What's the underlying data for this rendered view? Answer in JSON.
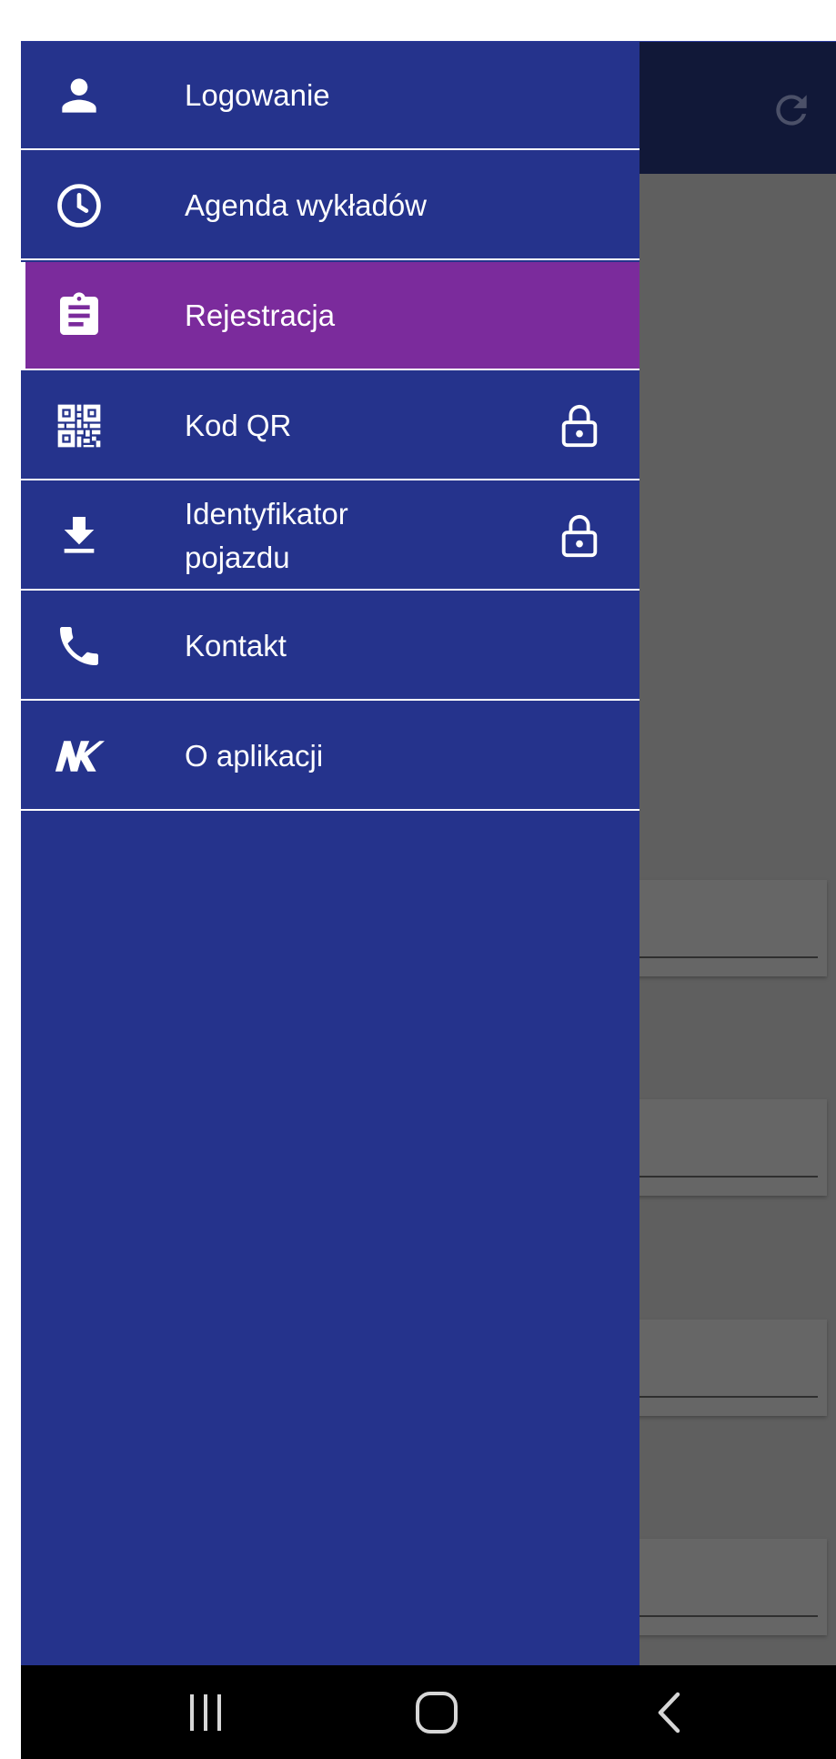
{
  "drawer": {
    "items": [
      {
        "label": "Logowanie",
        "icon": "person-icon",
        "active": false,
        "locked": false
      },
      {
        "label": "Agenda wykładów",
        "icon": "clock-icon",
        "active": false,
        "locked": false
      },
      {
        "label": "Rejestracja",
        "icon": "clipboard-icon",
        "active": true,
        "locked": false
      },
      {
        "label": "Kod QR",
        "icon": "qr-code-icon",
        "active": false,
        "locked": true
      },
      {
        "label": "Identyfikator pojazdu",
        "icon": "download-icon",
        "active": false,
        "locked": true
      },
      {
        "label": "Kontakt",
        "icon": "phone-icon",
        "active": false,
        "locked": false
      },
      {
        "label": "O aplikacji",
        "icon": "app-logo-icon",
        "active": false,
        "locked": false
      }
    ]
  },
  "header": {
    "refresh_icon": "refresh-icon"
  },
  "navbar": {
    "recents_icon": "recent-apps-icon",
    "home_icon": "home-icon",
    "back_icon": "back-icon"
  },
  "colors": {
    "drawer_bg": "#25338c",
    "active_item_bg": "#7b2b9c",
    "header_bg": "#111838",
    "scrim_bg": "#5f5f5f",
    "navbar_bg": "#000000"
  }
}
